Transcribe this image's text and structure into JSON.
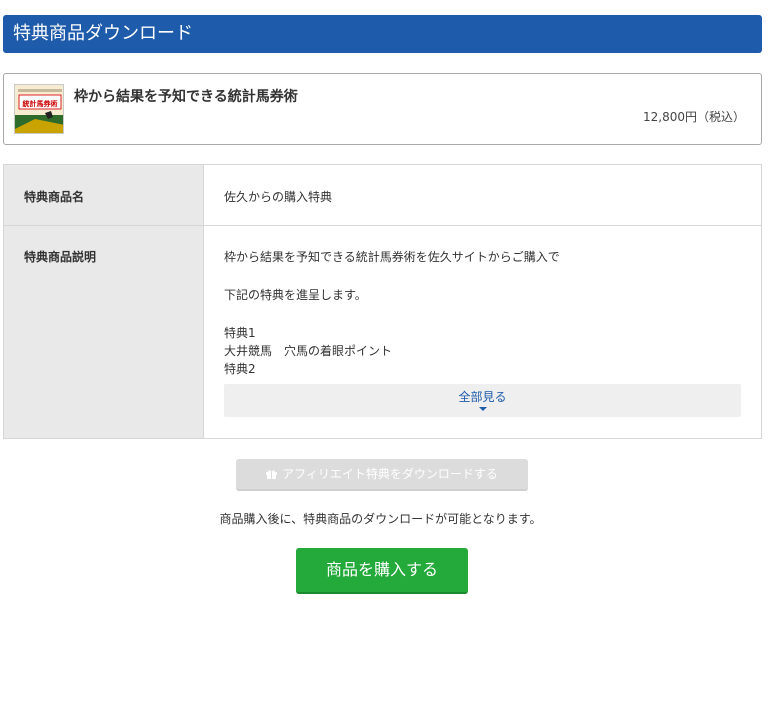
{
  "header": {
    "title": "特典商品ダウンロード"
  },
  "product": {
    "title": "枠から結果を予知できる統計馬券術",
    "price": "12,800円（税込）",
    "thumbnail_text": "統計馬券術"
  },
  "table": {
    "rows": [
      {
        "label": "特典商品名",
        "value": "佐久からの購入特典"
      },
      {
        "label": "特典商品説明",
        "lines": [
          "枠から結果を予知できる統計馬券術を佐久サイトからご購入で",
          "下記の特典を進呈します。",
          "特典1",
          "大井競馬　穴馬の着眼ポイント",
          "特典2"
        ]
      }
    ],
    "expand_label": "全部見る"
  },
  "affiliate_button": {
    "label": "アフィリエイト特典をダウンロードする",
    "icon": "gift-icon"
  },
  "notice": "商品購入後に、特典商品のダウンロードが可能となります。",
  "buy_button": {
    "label": "商品を購入する"
  },
  "colors": {
    "header": "#1e5bab",
    "buy": "#24a93b",
    "disabled": "#dcdcdc",
    "label_bg": "#e9e9e9"
  }
}
